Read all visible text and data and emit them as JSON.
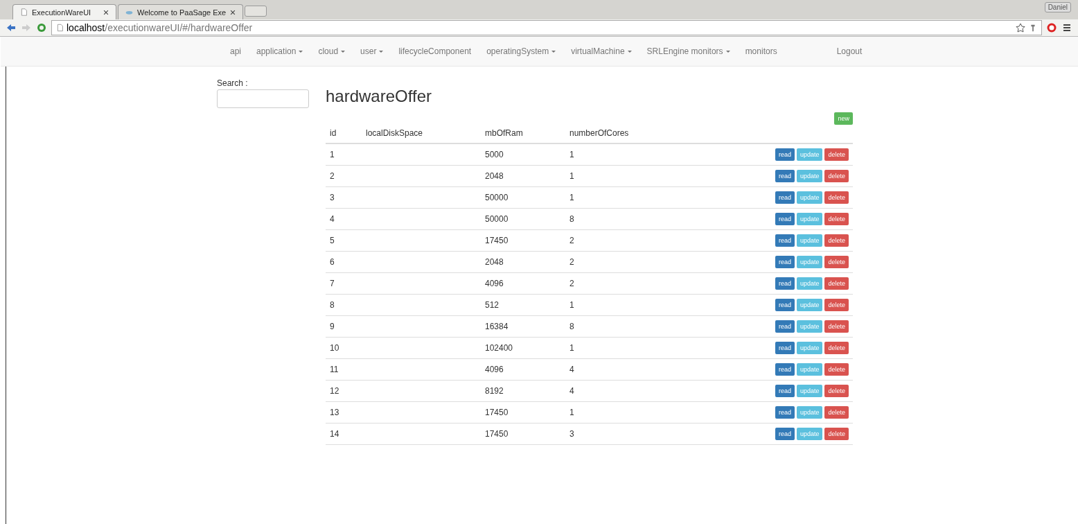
{
  "browser": {
    "tabs": [
      {
        "title": "ExecutionWareUI",
        "selected": true
      },
      {
        "title": "Welcome to PaaSage Exe",
        "selected": false
      }
    ],
    "address": {
      "host": "localhost",
      "path": "/executionwareUI/#/hardwareOffer"
    },
    "user": "Daniel"
  },
  "nav": [
    {
      "label": "api",
      "dropdown": false
    },
    {
      "label": "application",
      "dropdown": true
    },
    {
      "label": "cloud",
      "dropdown": true
    },
    {
      "label": "user",
      "dropdown": true
    },
    {
      "label": "lifecycleComponent",
      "dropdown": false
    },
    {
      "label": "operatingSystem",
      "dropdown": true
    },
    {
      "label": "virtualMachine",
      "dropdown": true
    },
    {
      "label": "SRLEngine monitors",
      "dropdown": true
    },
    {
      "label": "monitors",
      "dropdown": false
    }
  ],
  "logout": "Logout",
  "search": {
    "label": "Search :"
  },
  "title": "hardwareOffer",
  "new_button": "new",
  "table": {
    "columns": [
      "id",
      "localDiskSpace",
      "mbOfRam",
      "numberOfCores"
    ],
    "rows": [
      {
        "cells": [
          "1",
          "",
          "5000",
          "1"
        ],
        "actions": [
          {
            "label": "read",
            "kind": "primary"
          },
          {
            "label": "update",
            "kind": "info"
          },
          {
            "label": "delete",
            "kind": "danger"
          }
        ]
      },
      {
        "cells": [
          "2",
          "",
          "2048",
          "1"
        ],
        "actions": [
          {
            "label": "read",
            "kind": "primary"
          },
          {
            "label": "update",
            "kind": "info"
          },
          {
            "label": "delete",
            "kind": "danger"
          }
        ]
      },
      {
        "cells": [
          "3",
          "",
          "50000",
          "1"
        ],
        "actions": [
          {
            "label": "read",
            "kind": "primary"
          },
          {
            "label": "update",
            "kind": "info"
          },
          {
            "label": "delete",
            "kind": "danger"
          }
        ]
      },
      {
        "cells": [
          "4",
          "",
          "50000",
          "8"
        ],
        "actions": [
          {
            "label": "read",
            "kind": "primary"
          },
          {
            "label": "update",
            "kind": "info"
          },
          {
            "label": "delete",
            "kind": "danger"
          }
        ]
      },
      {
        "cells": [
          "5",
          "",
          "17450",
          "2"
        ],
        "actions": [
          {
            "label": "read",
            "kind": "primary"
          },
          {
            "label": "update",
            "kind": "info"
          },
          {
            "label": "delete",
            "kind": "danger"
          }
        ]
      },
      {
        "cells": [
          "6",
          "",
          "2048",
          "2"
        ],
        "actions": [
          {
            "label": "read",
            "kind": "primary"
          },
          {
            "label": "update",
            "kind": "info"
          },
          {
            "label": "delete",
            "kind": "danger"
          }
        ]
      },
      {
        "cells": [
          "7",
          "",
          "4096",
          "2"
        ],
        "actions": [
          {
            "label": "read",
            "kind": "primary"
          },
          {
            "label": "update",
            "kind": "info"
          },
          {
            "label": "delete",
            "kind": "danger"
          }
        ]
      },
      {
        "cells": [
          "8",
          "",
          "512",
          "1"
        ],
        "actions": [
          {
            "label": "read",
            "kind": "primary"
          },
          {
            "label": "update",
            "kind": "info"
          },
          {
            "label": "delete",
            "kind": "danger"
          }
        ]
      },
      {
        "cells": [
          "9",
          "",
          "16384",
          "8"
        ],
        "actions": [
          {
            "label": "read",
            "kind": "primary"
          },
          {
            "label": "update",
            "kind": "info"
          },
          {
            "label": "delete",
            "kind": "danger"
          }
        ]
      },
      {
        "cells": [
          "10",
          "",
          "102400",
          "1"
        ],
        "actions": [
          {
            "label": "read",
            "kind": "primary"
          },
          {
            "label": "update",
            "kind": "info"
          },
          {
            "label": "delete",
            "kind": "danger"
          }
        ]
      },
      {
        "cells": [
          "11",
          "",
          "4096",
          "4"
        ],
        "actions": [
          {
            "label": "read",
            "kind": "primary"
          },
          {
            "label": "update",
            "kind": "info"
          },
          {
            "label": "delete",
            "kind": "danger"
          }
        ]
      },
      {
        "cells": [
          "12",
          "",
          "8192",
          "4"
        ],
        "actions": [
          {
            "label": "read",
            "kind": "primary"
          },
          {
            "label": "update",
            "kind": "info"
          },
          {
            "label": "delete",
            "kind": "danger"
          }
        ]
      },
      {
        "cells": [
          "13",
          "",
          "17450",
          "1"
        ],
        "actions": [
          {
            "label": "read",
            "kind": "primary"
          },
          {
            "label": "update",
            "kind": "info"
          },
          {
            "label": "delete",
            "kind": "danger"
          }
        ]
      },
      {
        "cells": [
          "14",
          "",
          "17450",
          "3"
        ],
        "actions": [
          {
            "label": "read",
            "kind": "primary"
          },
          {
            "label": "update",
            "kind": "info"
          },
          {
            "label": "delete",
            "kind": "danger"
          }
        ]
      }
    ]
  }
}
